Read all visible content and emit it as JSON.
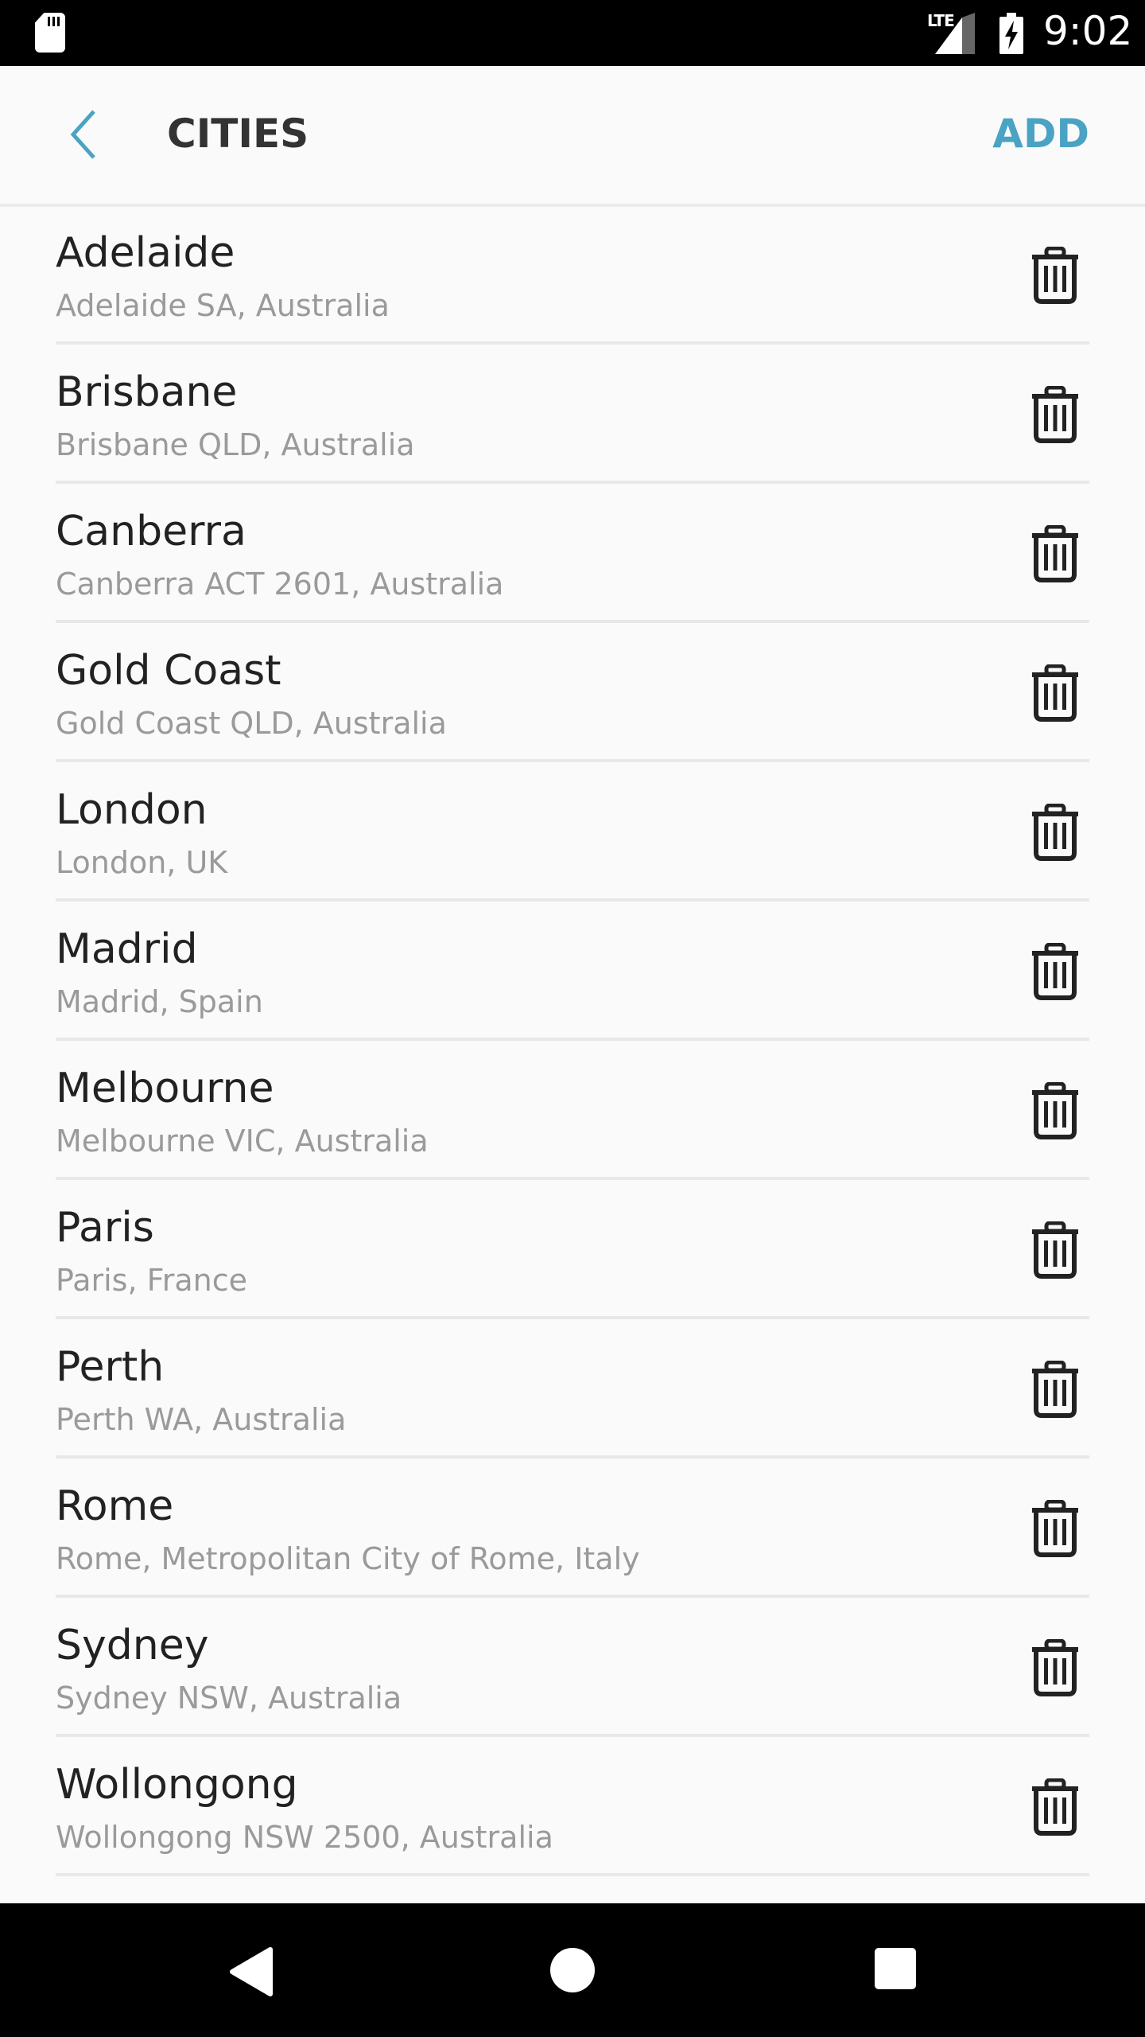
{
  "status_bar": {
    "time": "9:02",
    "network": "LTE",
    "icons": [
      "sd-card-icon",
      "signal-icon",
      "battery-charging-icon"
    ]
  },
  "header": {
    "back_icon": "chevron-left-icon",
    "title": "CITIES",
    "add_label": "ADD"
  },
  "colors": {
    "accent": "#4aa3c3",
    "title": "#333333",
    "subtitle": "#9a9a9a"
  },
  "cities": [
    {
      "name": "Adelaide",
      "address": "Adelaide SA, Australia"
    },
    {
      "name": "Brisbane",
      "address": "Brisbane QLD, Australia"
    },
    {
      "name": "Canberra",
      "address": "Canberra ACT 2601, Australia"
    },
    {
      "name": "Gold Coast",
      "address": "Gold Coast QLD, Australia"
    },
    {
      "name": "London",
      "address": "London, UK"
    },
    {
      "name": "Madrid",
      "address": "Madrid, Spain"
    },
    {
      "name": "Melbourne",
      "address": "Melbourne VIC, Australia"
    },
    {
      "name": "Paris",
      "address": "Paris, France"
    },
    {
      "name": "Perth",
      "address": "Perth WA, Australia"
    },
    {
      "name": "Rome",
      "address": "Rome, Metropolitan City of Rome, Italy"
    },
    {
      "name": "Sydney",
      "address": "Sydney NSW, Australia"
    },
    {
      "name": "Wollongong",
      "address": "Wollongong NSW 2500, Australia"
    }
  ],
  "nav_bar": {
    "icons": [
      "back-triangle-icon",
      "home-circle-icon",
      "recents-square-icon"
    ]
  }
}
